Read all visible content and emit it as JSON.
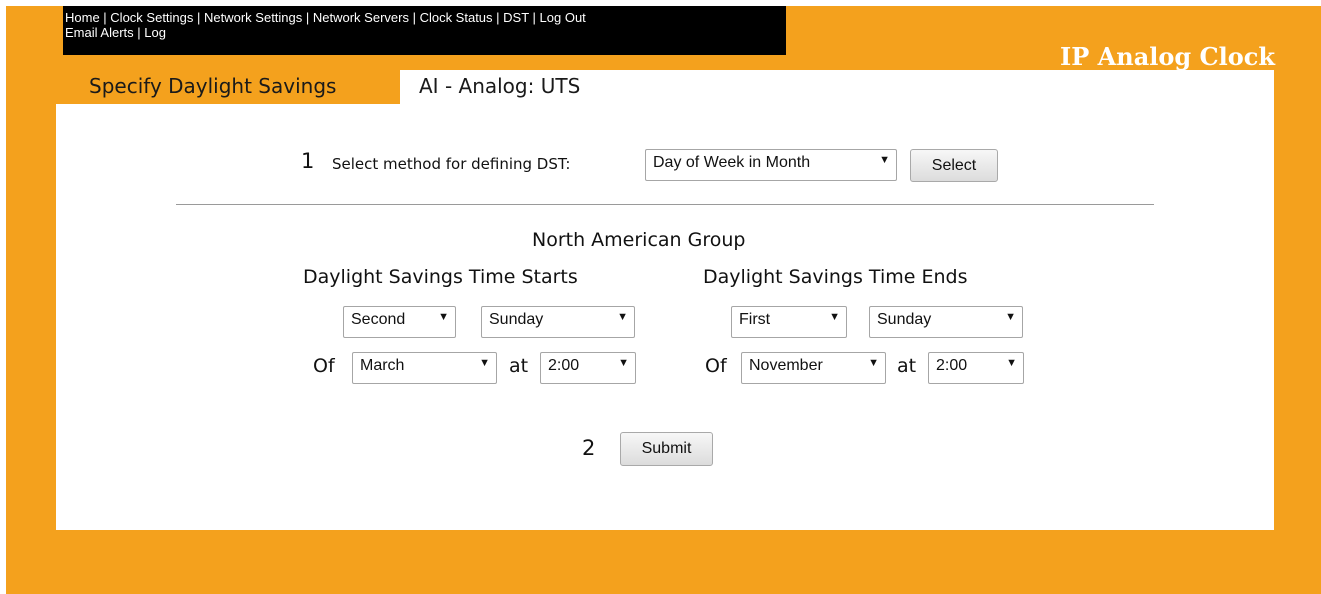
{
  "nav": {
    "line1": [
      {
        "label": "Home"
      },
      {
        "label": "Clock Settings"
      },
      {
        "label": "Network Settings"
      },
      {
        "label": "Network Servers"
      },
      {
        "label": "Clock Status"
      },
      {
        "label": "DST"
      },
      {
        "label": "Log Out"
      }
    ],
    "line2": [
      {
        "label": "Email Alerts"
      },
      {
        "label": "Log"
      }
    ],
    "separator": " | "
  },
  "brand": "IP Analog Clock",
  "page_heading": "Specify Daylight Savings",
  "device_name": "AI - Analog: UTS",
  "method": {
    "step_number": "1",
    "label": "Select method for defining DST:",
    "selected": "Day of Week in Month",
    "select_button": "Select"
  },
  "group_title": "North American Group",
  "dst_start": {
    "title": "Daylight Savings Time Starts",
    "week": "Second",
    "day": "Sunday",
    "of_label": "Of",
    "month": "March",
    "at_label": "at",
    "time": "2:00"
  },
  "dst_end": {
    "title": "Daylight Savings Time Ends",
    "week": "First",
    "day": "Sunday",
    "of_label": "Of",
    "month": "November",
    "at_label": "at",
    "time": "2:00"
  },
  "submit": {
    "step_number": "2",
    "label": "Submit"
  },
  "colors": {
    "frame": "#f4a11d",
    "nav_bg": "#000000",
    "panel": "#ffffff"
  },
  "icons": {
    "dropdown": "dropdown-arrow-icon",
    "arrow_glyph": "▼"
  }
}
